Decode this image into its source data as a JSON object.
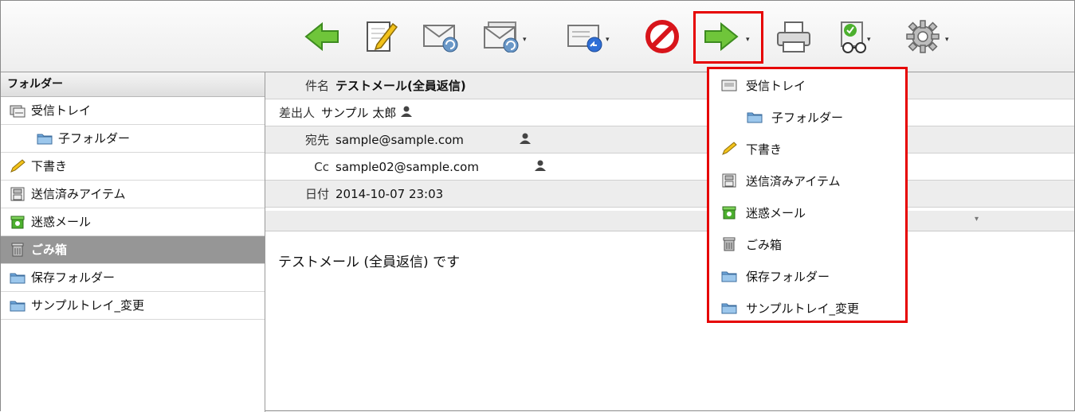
{
  "toolbar": {
    "buttons": [
      {
        "icon": "back-arrow-icon"
      },
      {
        "icon": "compose-icon"
      },
      {
        "icon": "reply-icon"
      },
      {
        "icon": "reply-all-icon",
        "has_menu": true
      },
      {
        "icon": "forward-icon",
        "has_menu": true
      },
      {
        "icon": "delete-icon"
      },
      {
        "icon": "move-arrow-icon",
        "has_menu": true
      },
      {
        "icon": "print-icon"
      },
      {
        "icon": "mark-icon",
        "has_menu": true
      },
      {
        "icon": "settings-gear-icon",
        "has_menu": true
      }
    ],
    "caret": "▾"
  },
  "sidebar": {
    "title": "フォルダー",
    "items": [
      {
        "label": "受信トレイ",
        "icon": "inbox-icon"
      },
      {
        "label": "子フォルダー",
        "icon": "folder-icon",
        "child": true
      },
      {
        "label": "下書き",
        "icon": "pencil-icon"
      },
      {
        "label": "送信済みアイテム",
        "icon": "sent-icon"
      },
      {
        "label": "迷惑メール",
        "icon": "junk-icon"
      },
      {
        "label": "ごみ箱",
        "icon": "trash-icon",
        "selected": true
      },
      {
        "label": "保存フォルダー",
        "icon": "folder-icon"
      },
      {
        "label": "サンプルトレイ_変更",
        "icon": "folder-icon"
      }
    ]
  },
  "message": {
    "subject_label": "件名",
    "subject": "テストメール(全員返信)",
    "from_label": "差出人",
    "from": "サンプル 太郎",
    "to_label": "宛先",
    "to": "sample@sample.com",
    "cc_label": "Cc",
    "cc": "sample02@sample.com",
    "date_label": "日付",
    "date": "2014-10-07 23:03",
    "body": "テストメール (全員返信) です"
  },
  "move_menu": {
    "items": [
      {
        "label": "受信トレイ",
        "icon": "inbox-icon"
      },
      {
        "label": "子フォルダー",
        "icon": "folder-icon",
        "child": true
      },
      {
        "label": "下書き",
        "icon": "pencil-icon"
      },
      {
        "label": "送信済みアイテム",
        "icon": "sent-icon"
      },
      {
        "label": "迷惑メール",
        "icon": "junk-icon"
      },
      {
        "label": "ごみ箱",
        "icon": "trash-icon"
      },
      {
        "label": "保存フォルダー",
        "icon": "folder-icon"
      },
      {
        "label": "サンプルトレイ_変更",
        "icon": "folder-icon"
      }
    ]
  },
  "colors": {
    "highlight": "#e60000",
    "selected_row": "#969696",
    "arrow_green": "#6fc53a",
    "delete_red": "#d8151b"
  }
}
